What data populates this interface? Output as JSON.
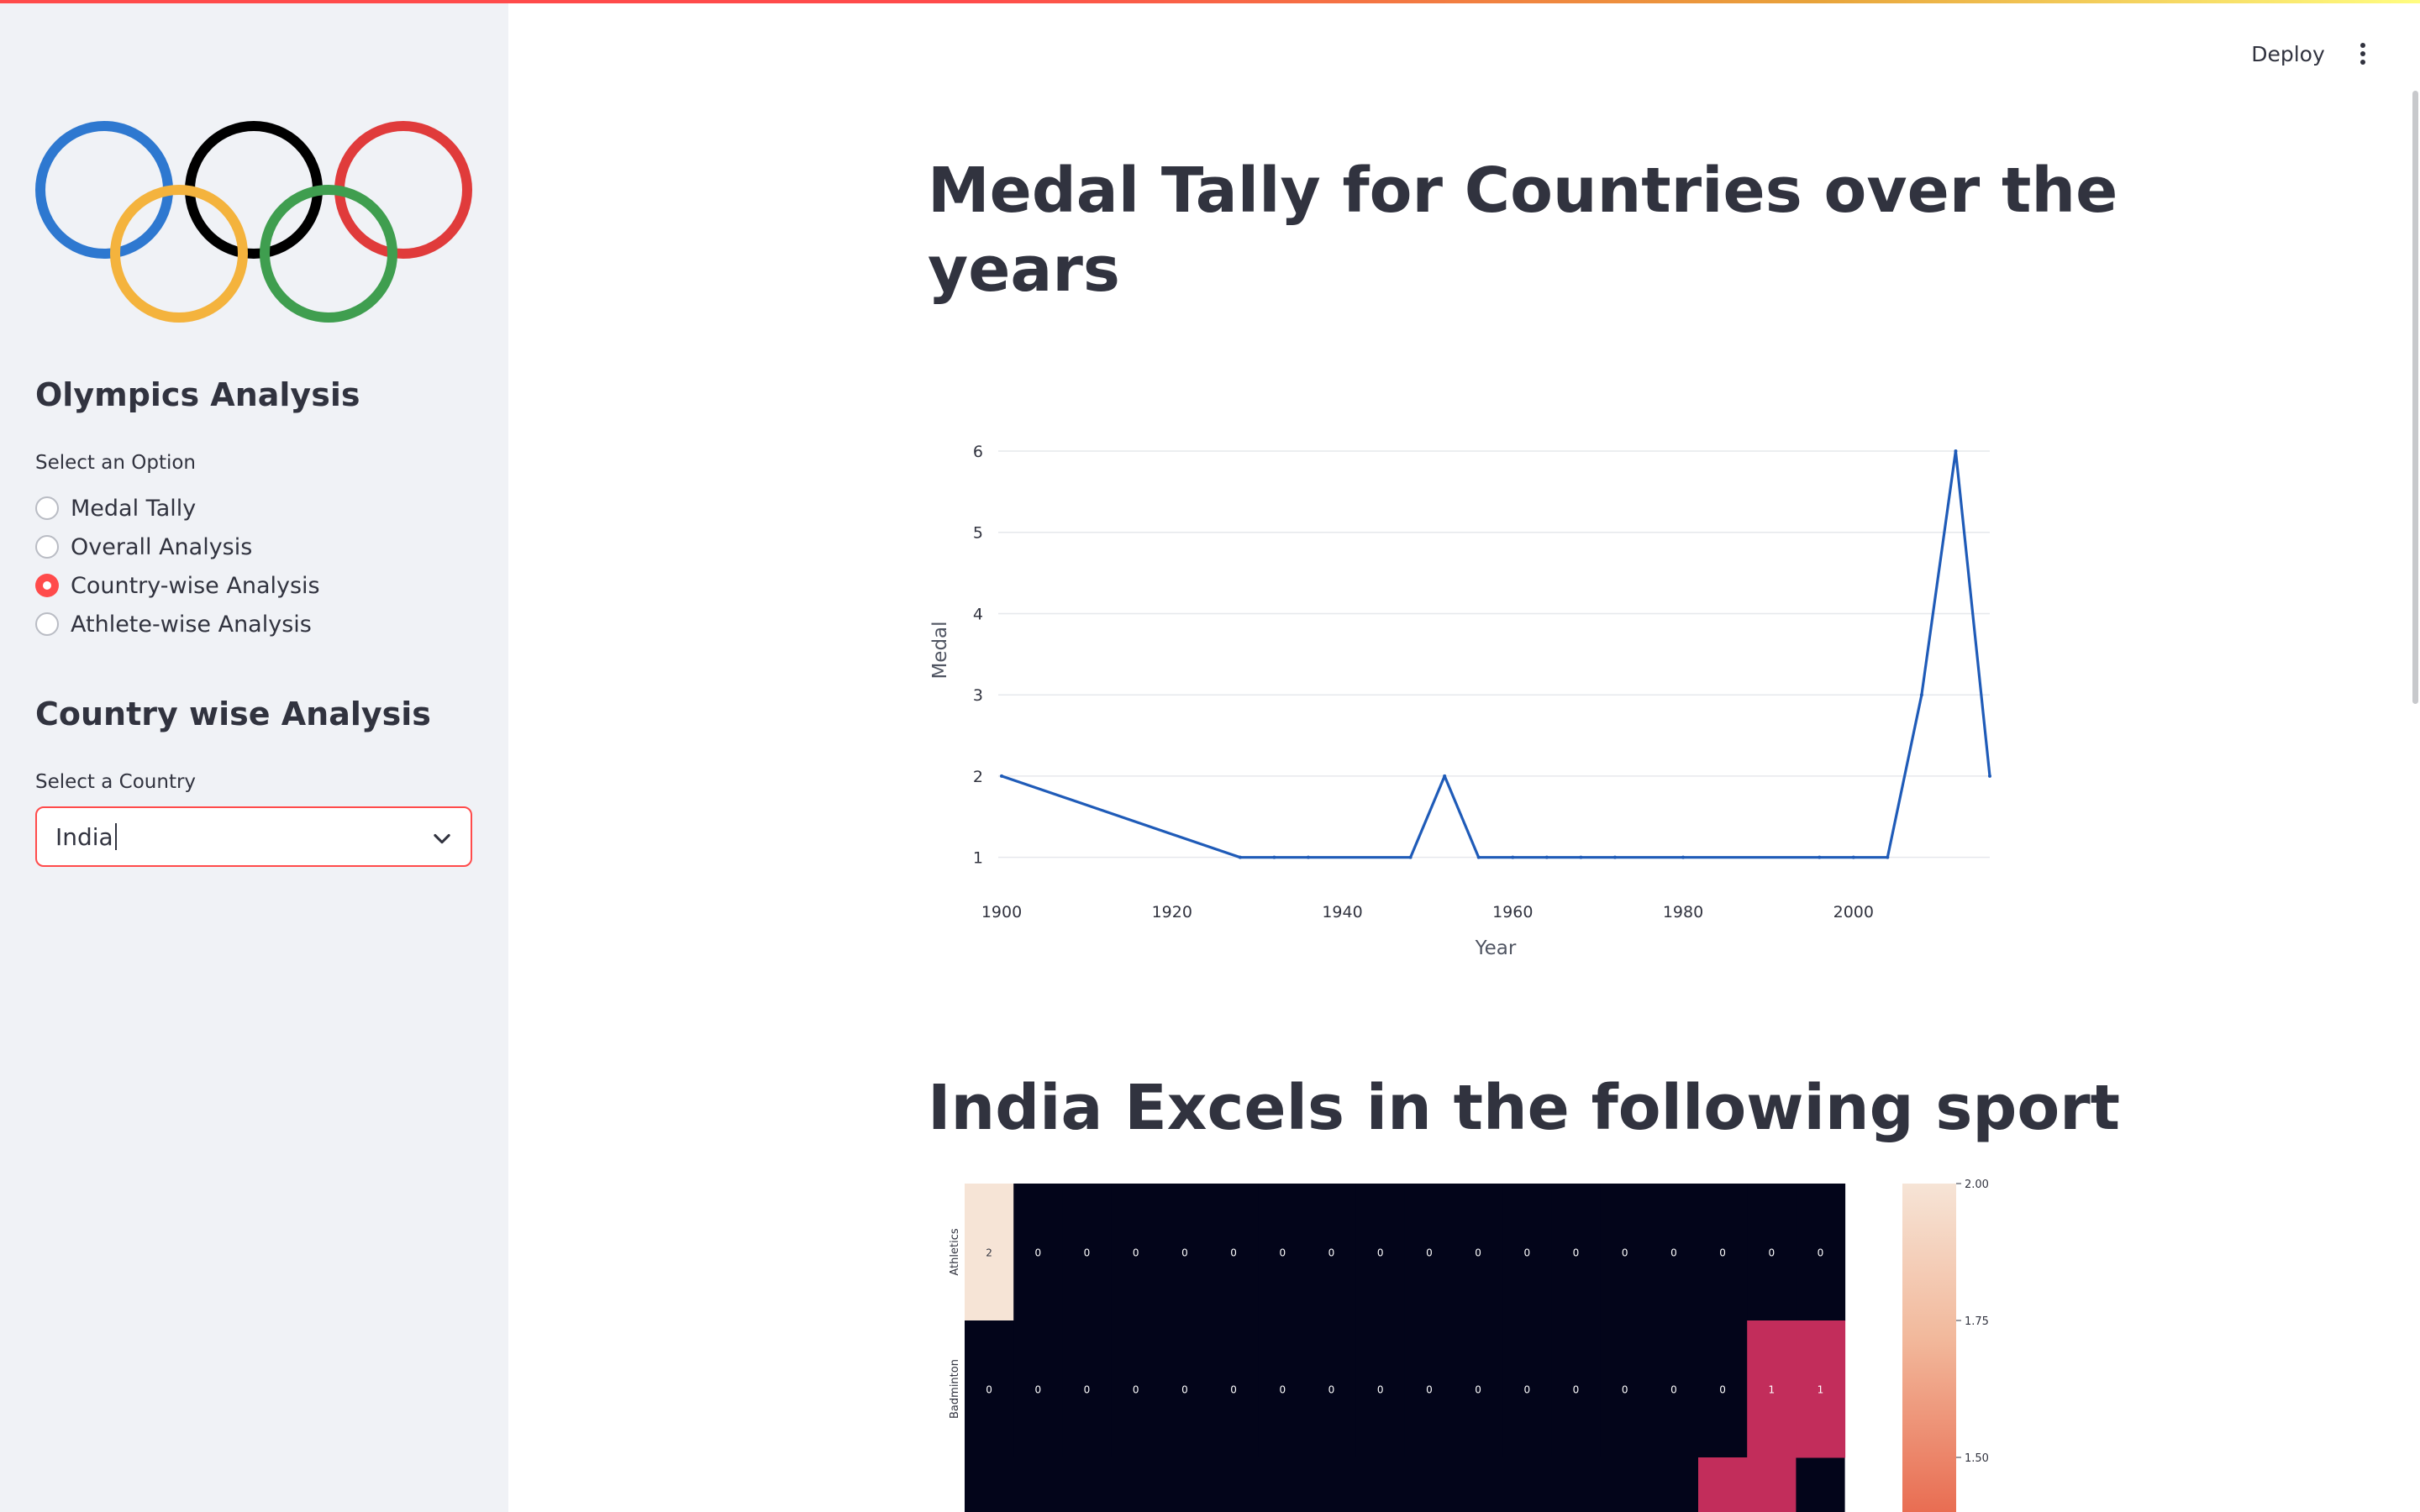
{
  "app": {
    "deploy_label": "Deploy",
    "menu_icon": "kebab-menu-icon",
    "accent_color": "#ff4b4b"
  },
  "sidebar": {
    "logo_icon": "olympic-rings-icon",
    "ring_colors": [
      "#2e78d0",
      "#000000",
      "#e03b3b",
      "#f4b33d",
      "#3f9e4f"
    ],
    "title": "Olympics Analysis",
    "option_label": "Select an Option",
    "options": [
      {
        "label": "Medal Tally",
        "selected": false
      },
      {
        "label": "Overall Analysis",
        "selected": false
      },
      {
        "label": "Country-wise Analysis",
        "selected": true
      },
      {
        "label": "Athlete-wise Analysis",
        "selected": false
      }
    ],
    "section_title": "Country wise Analysis",
    "country_label": "Select a Country",
    "country_value": "India"
  },
  "main": {
    "title_line1": "Medal Tally for Countries over the",
    "title_line2": "years",
    "heading2": "India Excels in the following sport"
  },
  "chart_data": [
    {
      "type": "line",
      "xlabel": "Year",
      "ylabel": "Medal",
      "x_ticks": [
        "1900",
        "1920",
        "1940",
        "1960",
        "1980",
        "2000"
      ],
      "y_ticks": [
        "1",
        "2",
        "3",
        "4",
        "5",
        "6"
      ],
      "xlim": [
        1900,
        2016
      ],
      "ylim": [
        0.8,
        6.3
      ],
      "grid": true,
      "series": [
        {
          "color": "#1f5bb8",
          "x": [
            1900,
            1928,
            1932,
            1936,
            1948,
            1952,
            1956,
            1960,
            1964,
            1968,
            1972,
            1980,
            1996,
            2000,
            2004,
            2008,
            2012,
            2016
          ],
          "y": [
            2,
            1,
            1,
            1,
            1,
            2,
            1,
            1,
            1,
            1,
            1,
            1,
            1,
            1,
            1,
            3,
            6,
            2
          ]
        }
      ]
    },
    {
      "type": "heatmap",
      "rows": [
        "Athletics",
        "Badminton"
      ],
      "columns": 18,
      "values": [
        [
          2,
          0,
          0,
          0,
          0,
          0,
          0,
          0,
          0,
          0,
          0,
          0,
          0,
          0,
          0,
          0,
          0,
          0
        ],
        [
          0,
          0,
          0,
          0,
          0,
          0,
          0,
          0,
          0,
          0,
          0,
          0,
          0,
          0,
          0,
          0,
          1,
          1
        ]
      ],
      "colorbar_ticks": [
        "2.00",
        "1.75",
        "1.50"
      ]
    }
  ]
}
